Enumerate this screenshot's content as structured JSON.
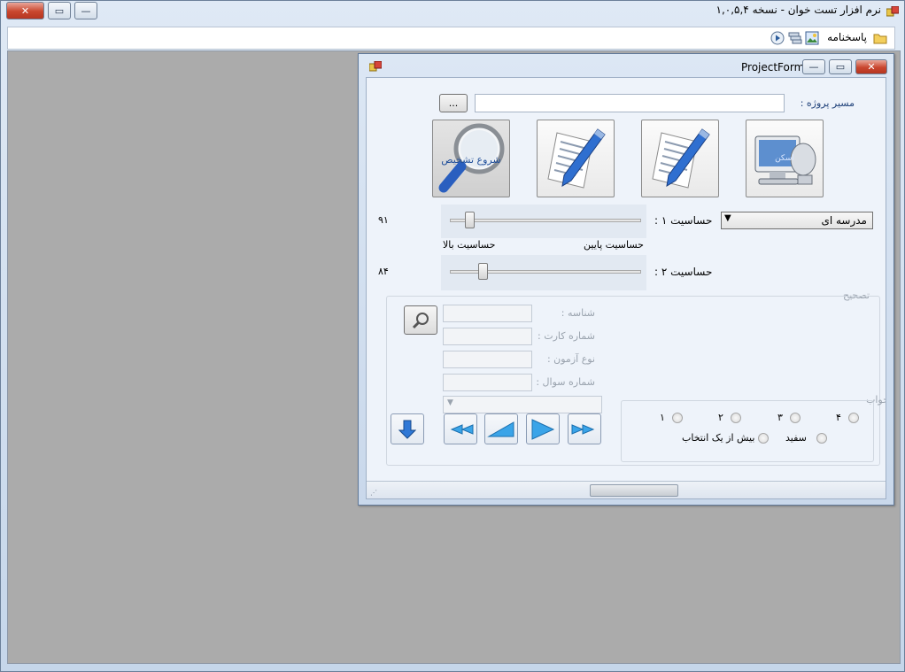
{
  "main_window": {
    "title": "نرم افزار تست خوان - نسخه ۱,۰,۵,۴",
    "buttons": {
      "close": "✕",
      "restore": "▭",
      "minimize": "—"
    },
    "menu": {
      "answer_sheet_label": "پاسخنامه"
    }
  },
  "project_form": {
    "title": "ProjectForm",
    "buttons": {
      "close": "✕",
      "restore": "▭",
      "minimize": "—"
    },
    "path_label": "مسیر پروژه :",
    "path_value": "",
    "browse_button": "...",
    "toolbar_buttons": [
      {
        "caption": "اسکن",
        "icon": "scanner-icon"
      },
      {
        "caption": "",
        "icon": "edit-document-icon"
      },
      {
        "caption": "",
        "icon": "edit-document-icon"
      },
      {
        "caption": "شروع تشخیص",
        "icon": "magnifier-icon"
      }
    ],
    "school_combo_value": "مدرسه ای",
    "sensitivity1_label": "حساسیت ۱ :",
    "sensitivity1_value": "۹۱",
    "sensitivity_low": "حساسیت پایین",
    "sensitivity_high": "حساسیت بالا",
    "sensitivity2_label": "حساسیت ۲ :",
    "sensitivity2_value": "۸۴",
    "correction_group": {
      "title": "تصحیح",
      "id_label": "شناسه :",
      "card_label": "شماره کارت :",
      "exam_type_label": "نوع آزمون :",
      "question_label": "شماره سوال :",
      "answer_group": {
        "title": "جواب",
        "options": [
          "۱",
          "۲",
          "۳",
          "۴"
        ],
        "blank": "سفید",
        "multiple": "بیش از یک انتخاب"
      }
    }
  },
  "colors": {
    "mdi_background": "#ababab",
    "accent_blue": "#2f6fd0"
  }
}
